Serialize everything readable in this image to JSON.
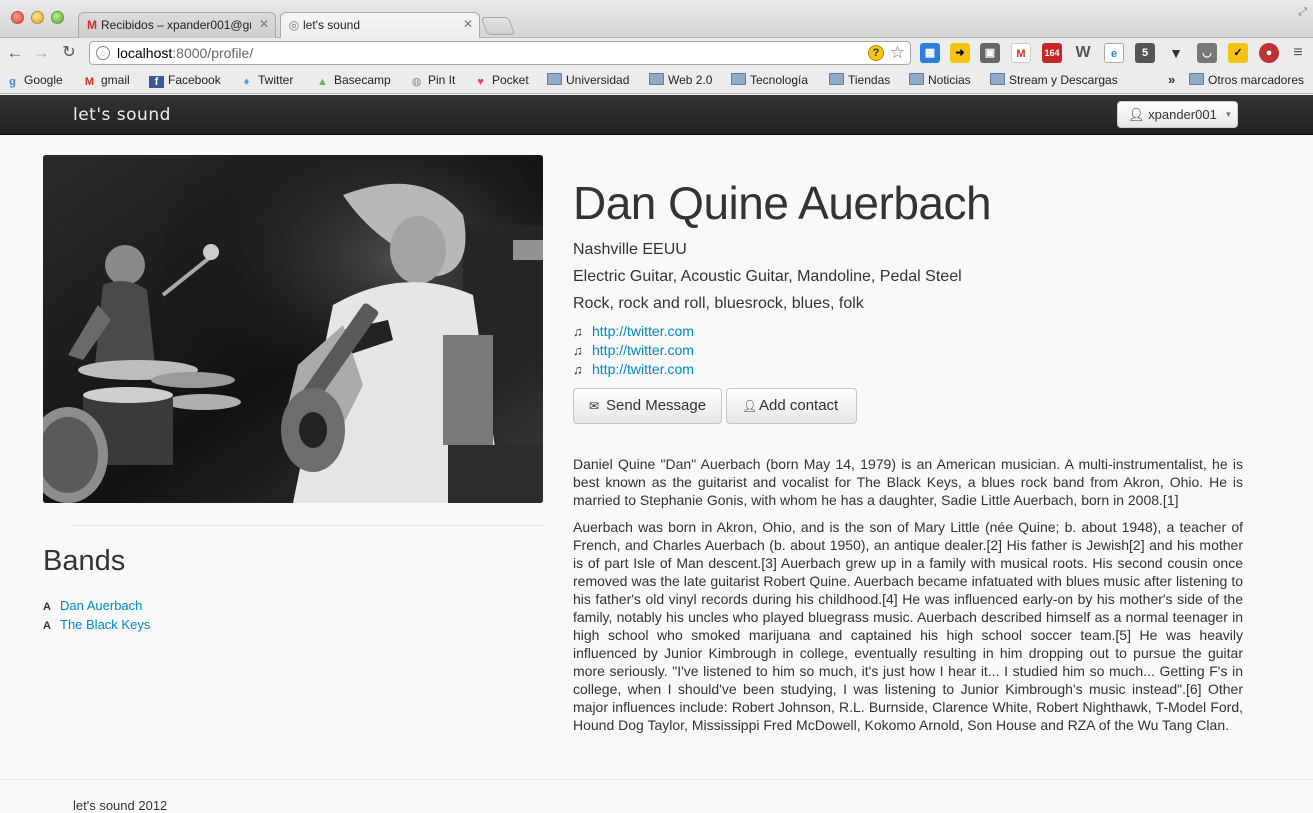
{
  "browser": {
    "tabs": [
      {
        "title": "Recibidos – xpander001@gm",
        "icon": "gmail-icon",
        "active": false
      },
      {
        "title": "let's sound",
        "icon": "globe-icon",
        "active": true
      }
    ],
    "url_host": "localhost",
    "url_rest": ":8000/profile/",
    "bookmarks": [
      {
        "label": "Google",
        "icon": "google-icon"
      },
      {
        "label": "gmail",
        "icon": "gmail-icon"
      },
      {
        "label": "Facebook",
        "icon": "facebook-icon"
      },
      {
        "label": "Twitter",
        "icon": "twitter-icon"
      },
      {
        "label": "Basecamp",
        "icon": "basecamp-icon"
      },
      {
        "label": "Pin It",
        "icon": "pin-icon"
      },
      {
        "label": "Pocket",
        "icon": "pocket-icon"
      },
      {
        "label": "Universidad",
        "icon": "folder-icon"
      },
      {
        "label": "Web 2.0",
        "icon": "folder-icon"
      },
      {
        "label": "Tecnología",
        "icon": "folder-icon"
      },
      {
        "label": "Tiendas",
        "icon": "folder-icon"
      },
      {
        "label": "Noticias",
        "icon": "folder-icon"
      },
      {
        "label": "Stream y Descargas",
        "icon": "folder-icon"
      }
    ],
    "other_bookmarks": "Otros marcadores",
    "extension_badge": "164"
  },
  "navbar": {
    "brand": "let's sound",
    "user": "xpander001"
  },
  "profile": {
    "name": "Dan Quine Auerbach",
    "location": "Nashville EEUU",
    "instruments": "Electric Guitar, Acoustic Guitar, Mandoline, Pedal Steel",
    "genres": "Rock, rock and roll, bluesrock, blues, folk",
    "links": [
      "http://twitter.com",
      "http://twitter.com",
      "http://twitter.com"
    ],
    "send_message_label": "Send Message",
    "add_contact_label": "Add contact",
    "bio": [
      "Daniel Quine \"Dan\" Auerbach (born May 14, 1979) is an American musician. A multi-instrumentalist, he is best known as the guitarist and vocalist for The Black Keys, a blues rock band from Akron, Ohio. He is married to Stephanie Gonis, with whom he has a daughter, Sadie Little Auerbach, born in 2008.[1]",
      "Auerbach was born in Akron, Ohio, and is the son of Mary Little (née Quine; b. about 1948), a teacher of French, and Charles Auerbach (b. about 1950), an antique dealer.[2] His father is Jewish[2] and his mother is of part Isle of Man descent.[3] Auerbach grew up in a family with musical roots. His second cousin once removed was the late guitarist Robert Quine. Auerbach became infatuated with blues music after listening to his father's old vinyl records during his childhood.[4] He was influenced early-on by his mother's side of the family, notably his uncles who played bluegrass music. Auerbach described himself as a normal teenager in high school who smoked marijuana and captained his high school soccer team.[5] He was heavily influenced by Junior Kimbrough in college, eventually resulting in him dropping out to pursue the guitar more seriously. \"I've listened to him so much, it's just how I hear it... I studied him so much... Getting F's in college, when I should've been studying, I was listening to Junior Kimbrough's music instead\".[6] Other major influences include: Robert Johnson, R.L. Burnside, Clarence White, Robert Nighthawk, T-Model Ford, Hound Dog Taylor, Mississippi Fred McDowell, Kokomo Arnold, Son House and RZA of the Wu Tang Clan."
    ]
  },
  "bands": {
    "title": "Bands",
    "items": [
      "Dan Auerbach",
      "The Black Keys"
    ]
  },
  "footer": {
    "text": "let's sound 2012"
  }
}
